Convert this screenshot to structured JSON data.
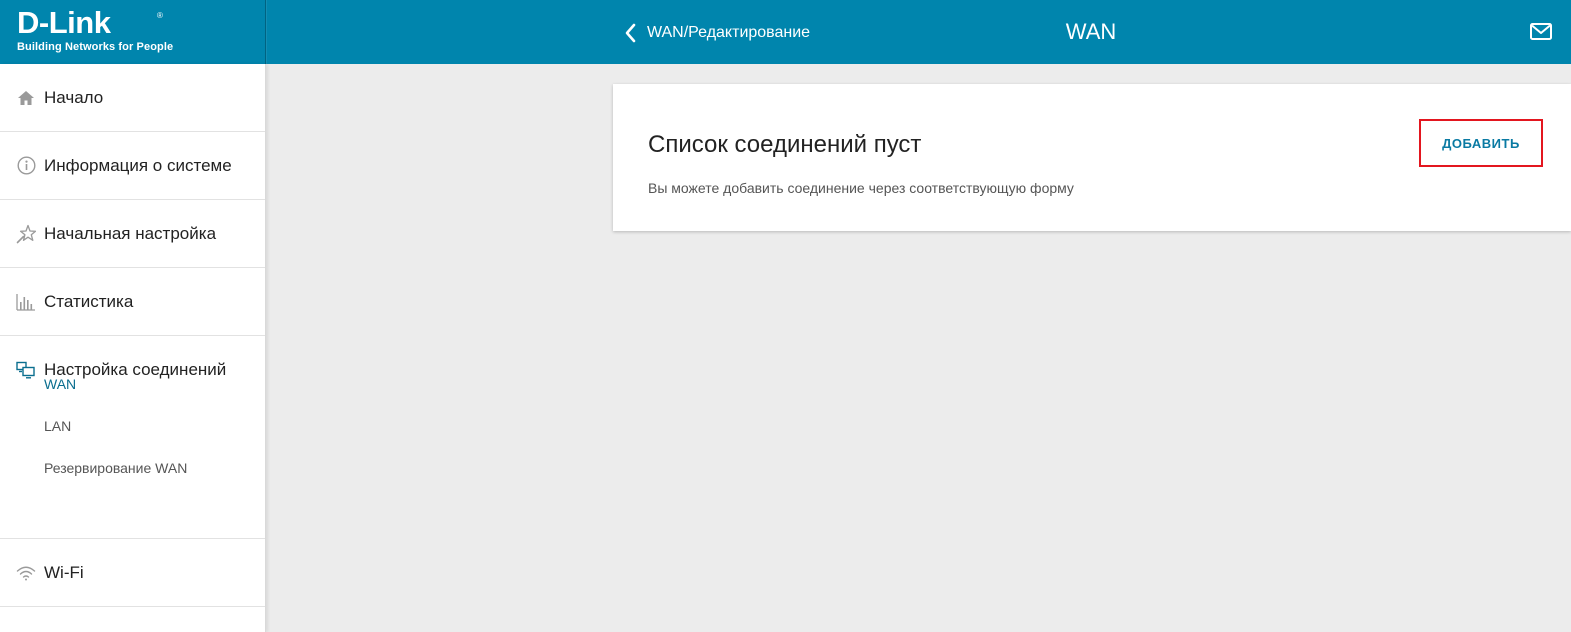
{
  "brand": {
    "logo_text": "D-Link",
    "registered_mark": "®",
    "tagline": "Building Networks for People"
  },
  "header": {
    "back_label": "WAN/Редактирование",
    "title": "WAN",
    "icons": {
      "back": "chevron-left-icon",
      "mail": "mail-icon"
    }
  },
  "sidebar": {
    "items": [
      {
        "label": "Начало",
        "icon": "home-icon"
      },
      {
        "label": "Информация о системе",
        "icon": "info-icon"
      },
      {
        "label": "Начальная настройка",
        "icon": "wizard-star-icon"
      },
      {
        "label": "Статистика",
        "icon": "bar-chart-icon"
      },
      {
        "label": "Настройка соединений",
        "icon": "connections-icon"
      },
      {
        "label": "Wi-Fi",
        "icon": "wifi-icon"
      }
    ],
    "subitems": [
      {
        "label": "WAN",
        "active": true
      },
      {
        "label": "LAN",
        "active": false
      },
      {
        "label": "Резервирование WAN",
        "active": false
      }
    ]
  },
  "main": {
    "card_title": "Список соединений пуст",
    "card_description": "Вы можете добавить соединение через соответствующую форму",
    "add_button_label": "ДОБАВИТЬ"
  },
  "colors": {
    "header_bg": "#0085ad",
    "accent_text": "#0a7aa3",
    "highlight_border": "#e3161f",
    "page_bg": "#ececec"
  }
}
